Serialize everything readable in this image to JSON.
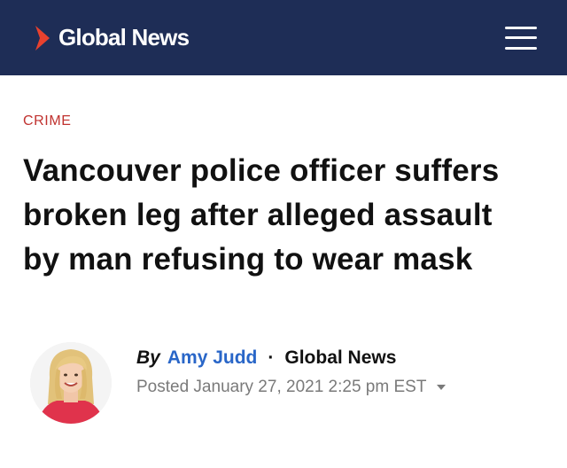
{
  "header": {
    "logo_text": "Global News",
    "brand_color": "#1e2d56",
    "logo_accent": "#e8412e",
    "logo_icon": "chevron-logo-icon",
    "menu_icon": "hamburger-menu-icon"
  },
  "article": {
    "category": "CRIME",
    "headline": "Vancouver police officer suffers broken leg after alleged assault by man refusing to wear mask",
    "byline": {
      "by": "By",
      "author": "Amy Judd",
      "separator": "·",
      "source": "Global News",
      "posted": "Posted January 27, 2021 2:25 pm EST",
      "author_color": "#2966c8"
    }
  }
}
